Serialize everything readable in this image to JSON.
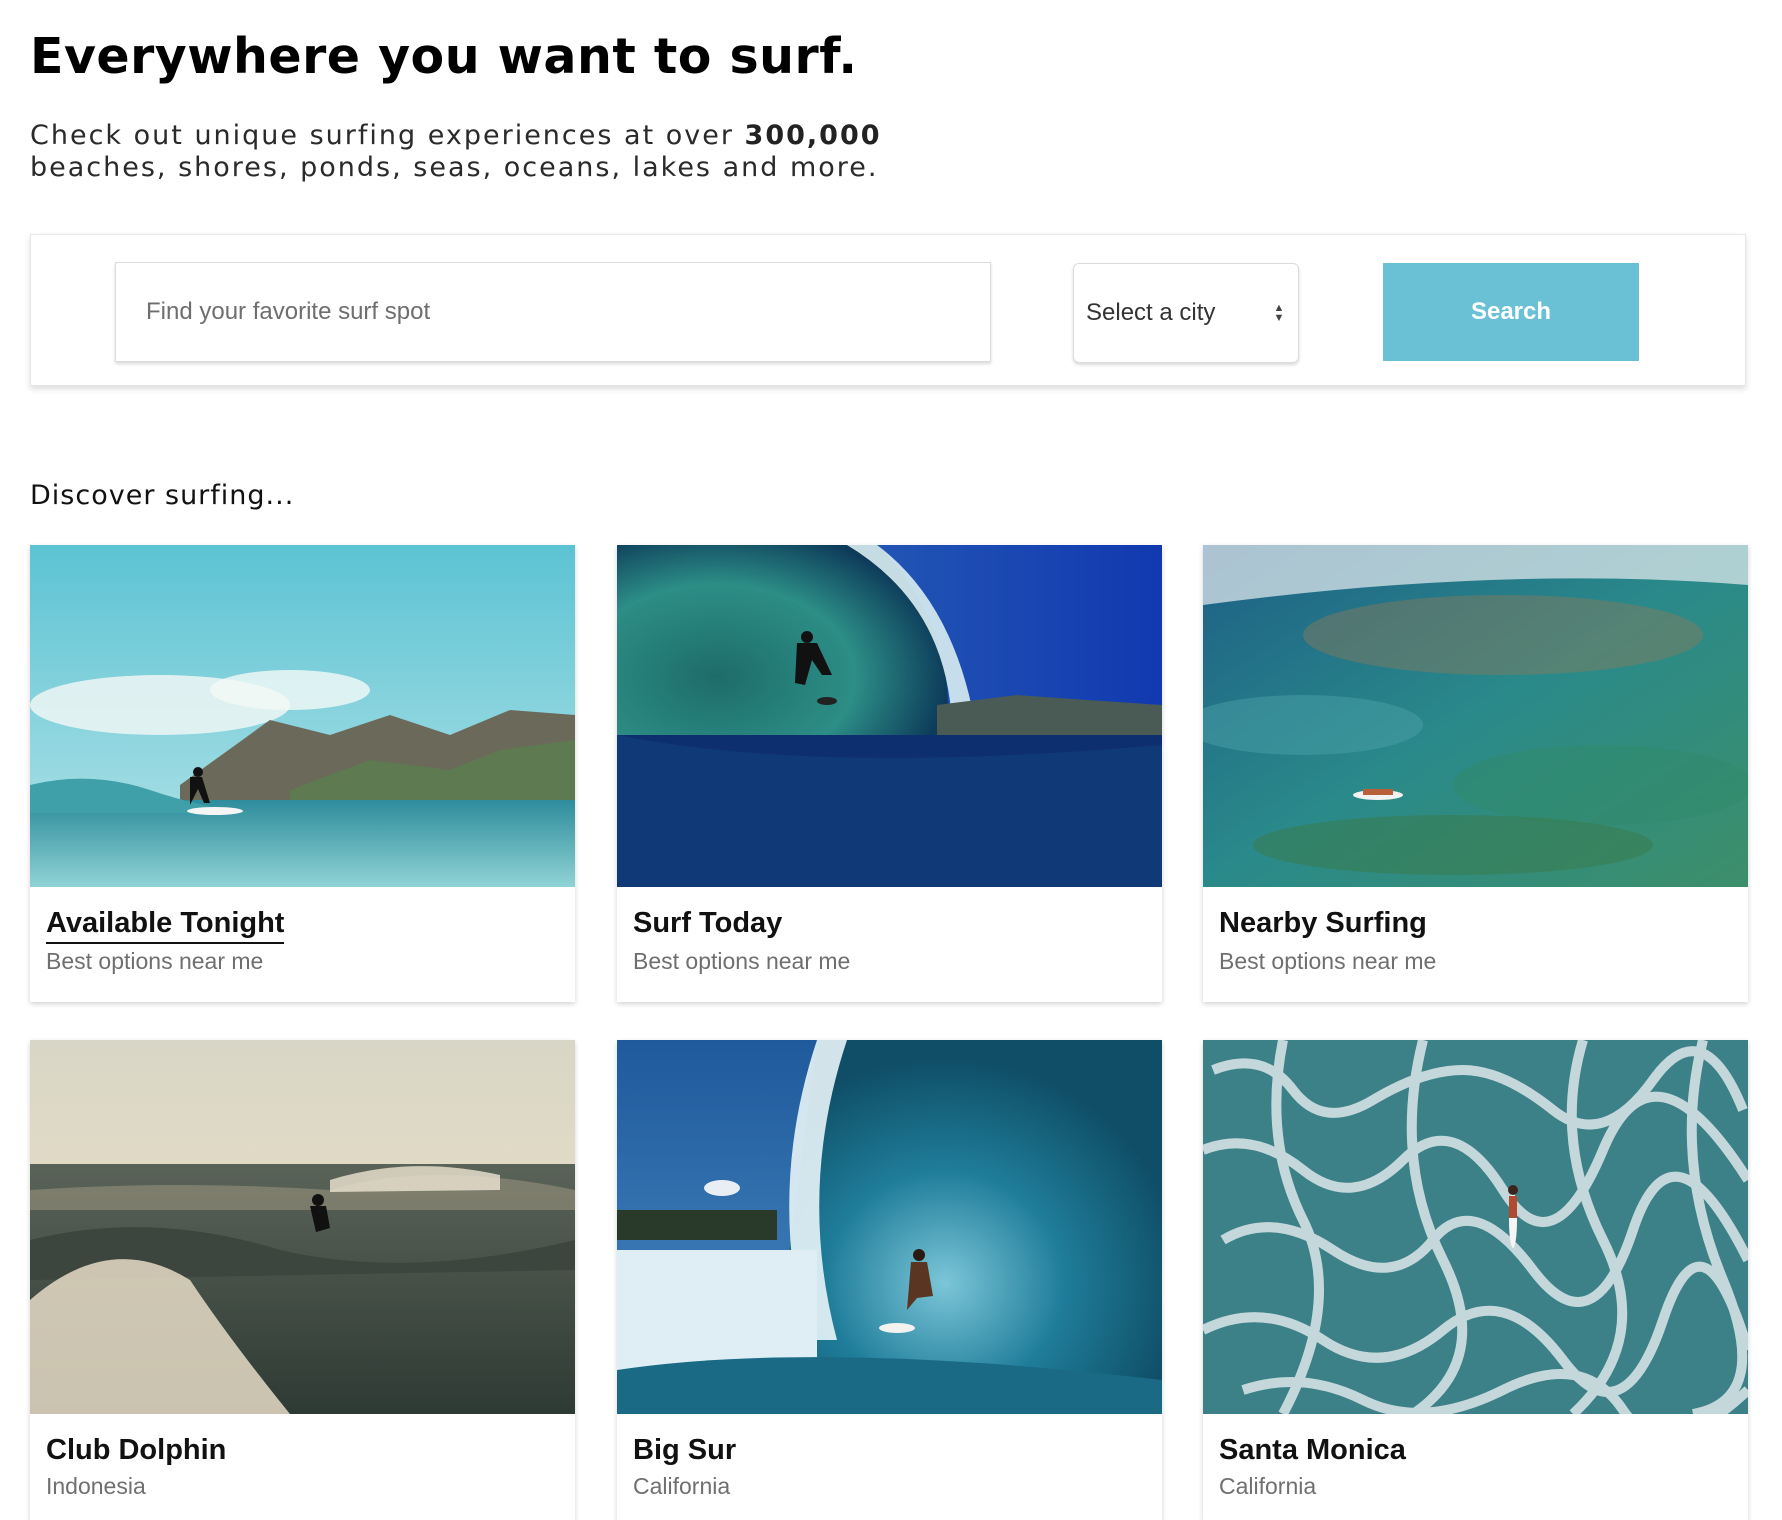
{
  "hero": {
    "title": "Everywhere you want to surf.",
    "subtitle_part1": "Check out unique surfing experiences at over ",
    "subtitle_bold": "300,000",
    "subtitle_part2": "beaches, shores, ponds, seas, oceans, lakes and more."
  },
  "search": {
    "placeholder": "Find your favorite surf spot",
    "value": "",
    "city_select": "Select a city",
    "button_label": "Search",
    "button_color": "#6ac0d5"
  },
  "discover": {
    "title": "Discover surfing...",
    "cards": [
      {
        "title": "Available Tonight",
        "subtitle": "Best options near me",
        "image": "surfer-coastline-photo"
      },
      {
        "title": "Surf Today",
        "subtitle": "Best options near me",
        "image": "barrel-wave-photo"
      },
      {
        "title": "Nearby Surfing",
        "subtitle": "Best options near me",
        "image": "aerial-paddler-photo"
      },
      {
        "title": "Club Dolphin",
        "subtitle": "Indonesia",
        "image": "sunset-surf-photo"
      },
      {
        "title": "Big Sur",
        "subtitle": "California",
        "image": "tube-ride-photo"
      },
      {
        "title": "Santa Monica",
        "subtitle": "California",
        "image": "foam-aerial-photo"
      }
    ]
  }
}
